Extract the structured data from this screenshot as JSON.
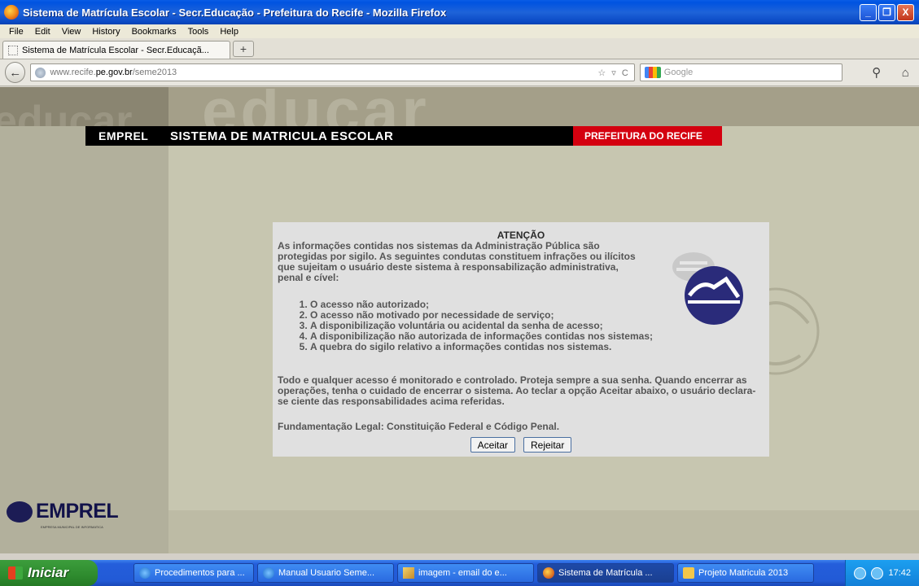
{
  "window": {
    "title": "Sistema de Matrícula Escolar - Secr.Educação - Prefeitura do Recife - Mozilla Firefox",
    "min_label": "_",
    "max_label": "❐",
    "close_label": "X"
  },
  "menu": {
    "file": "File",
    "edit": "Edit",
    "view": "View",
    "history": "History",
    "bookmarks": "Bookmarks",
    "tools": "Tools",
    "help": "Help"
  },
  "tab": {
    "label": "Sistema de Matrícula Escolar - Secr.Educaçã...",
    "new_tab": "+"
  },
  "nav": {
    "back": "←",
    "url_prefix": "www.recife.",
    "url_host": "pe.gov.br",
    "url_path": "/seme2013",
    "url_controls": "☆ ▿ C",
    "search_placeholder": "Google",
    "search_go": "⚲",
    "home": "⌂"
  },
  "page": {
    "watermark": "educar",
    "watermark_left": "educar",
    "header": {
      "emprel": "EMPREL",
      "system": "SISTEMA DE MATRICULA ESCOLAR",
      "prefeitura": "PREFEITURA DO RECIFE"
    },
    "dialog": {
      "title": "ATENÇÃO",
      "intro": "As informações contidas nos sistemas da Administração Pública são protegidas por sigilo. As seguintes condutas constituem infrações ou ilícitos que sujeitam o usuário deste sistema à responsabilização administrativa, penal e cível:",
      "items": [
        "O acesso não autorizado;",
        "O acesso não motivado por necessidade de serviço;",
        "A disponibilização voluntária ou acidental da senha de acesso;",
        "A disponibilização não autorizada de informações contidas nos sistemas;",
        "A quebra do sigilo relativo a informações contidas nos sistemas."
      ],
      "monitor": "Todo e qualquer acesso é monitorado e controlado. Proteja sempre a sua senha. Quando encerrar as operações, tenha o cuidado de encerrar o sistema. Ao teclar a opção Aceitar abaixo, o usuário declara-se ciente das responsabilidades acima referidas.",
      "legal": "Fundamentação Legal: Constituição Federal e Código Penal.",
      "accept": "Aceitar",
      "reject": "Rejeitar"
    },
    "footer_logo": {
      "name": "EMPREL",
      "subtitle": "EMPRESA MUNICIPAL DE INFORMATICA"
    }
  },
  "taskbar": {
    "start": "Iniciar",
    "tasks": [
      "Procedimentos para ...",
      "Manual Usuario Seme...",
      "imagem - email do e...",
      "Sistema de Matrícula ...",
      "Projeto Matricula 2013"
    ],
    "clock": "17:42"
  }
}
